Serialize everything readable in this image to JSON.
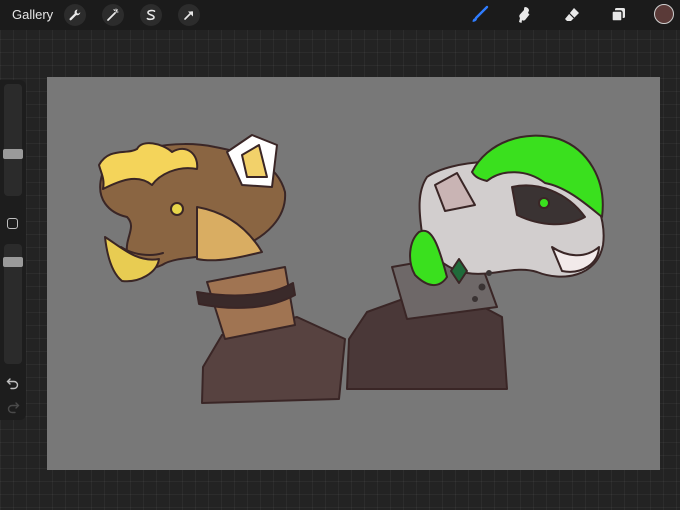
{
  "toolbar": {
    "gallery_label": "Gallery",
    "left_tools": [
      "wrench-icon",
      "magic-wand-icon",
      "selection-icon",
      "transform-arrow-icon"
    ],
    "right_tools": [
      "brush-icon",
      "smudge-icon",
      "eraser-icon",
      "layers-icon"
    ],
    "active_tool": "brush",
    "brush_accent_color": "#2f7dff",
    "current_color": "#5a3a38"
  },
  "sidebar": {
    "brush_size_level": 0.36,
    "brush_opacity_level": 0.12,
    "controls": [
      "brush-size-slider",
      "modify-button",
      "opacity-slider",
      "undo-icon",
      "redo-icon"
    ]
  },
  "canvas": {
    "background_color": "#787878",
    "content": "character-sketch-artwork"
  }
}
